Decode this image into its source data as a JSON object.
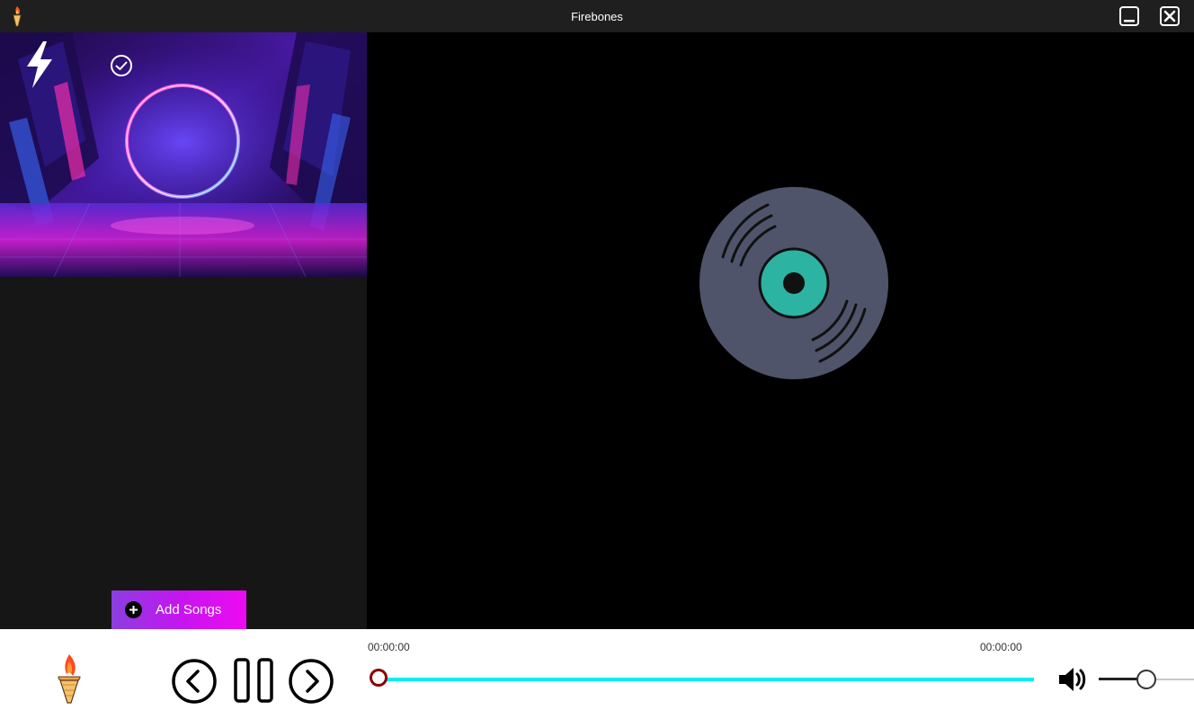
{
  "window": {
    "title": "Firebones",
    "logo_icon": "torch-icon",
    "minimize_icon": "minimize-icon",
    "close_icon": "close-icon"
  },
  "sidebar": {
    "banner_icon_left": "lightning-bolt-icon",
    "banner_icon_right": "check-circle-icon",
    "add_songs_label": "Add Songs",
    "add_songs_icon": "plus-circle-icon",
    "add_songs_gradient": [
      "#8a3fe0",
      "#ee0af2"
    ]
  },
  "main": {
    "placeholder_icon": "vinyl-record-icon",
    "vinyl_color": "#4f546a",
    "vinyl_label_color": "#2db3a2"
  },
  "player": {
    "logo_icon": "torch-icon",
    "prev_icon": "chevron-left-icon",
    "pause_icon": "pause-icon",
    "next_icon": "chevron-right-icon",
    "elapsed": "00:00:00",
    "total": "00:00:00",
    "progress": 0,
    "progress_color": "#00f0f0",
    "thumb_color": "#8b0000",
    "volume_icon": "volume-icon",
    "volume": 0.5
  }
}
